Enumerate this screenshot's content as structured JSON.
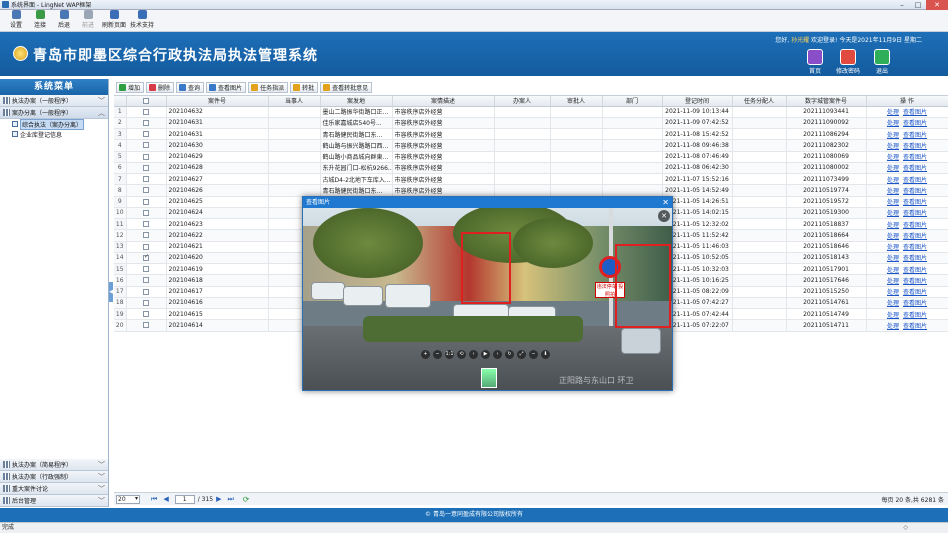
{
  "window": {
    "title": "系统界面 - LingNet WAP框架"
  },
  "toolbar": [
    {
      "label": "设置",
      "color": "#4a78b5",
      "disabled": false
    },
    {
      "label": "连接",
      "color": "#3a9a45",
      "disabled": false
    },
    {
      "label": "后退",
      "color": "#4a78b5",
      "disabled": false
    },
    {
      "label": "前进",
      "color": "#9aa6b5",
      "disabled": true
    },
    {
      "label": "刷新页面",
      "color": "#3a6fb8",
      "disabled": false
    },
    {
      "label": "技术支持",
      "color": "#3a6fb8",
      "disabled": false
    }
  ],
  "header": {
    "title": "青岛市即墨区综合行政执法局执法管理系统",
    "greeting_prefix": "您好,",
    "username": "孙光耀",
    "greeting_suffix": "欢迎登录!   今天是2021年11月9日 星期二",
    "buttons": [
      {
        "label": "首页",
        "color": "#8a4fc8"
      },
      {
        "label": "修改密码",
        "color": "#e04a3f"
      },
      {
        "label": "退出",
        "color": "#2fae5a"
      }
    ]
  },
  "sidebar": {
    "title": "系统菜单",
    "groups_top": [
      {
        "label": "执法办案（一般程序）",
        "chevron": "﹀",
        "open": false
      },
      {
        "label": "案办分离（一般程序）",
        "chevron": "︿",
        "open": true
      }
    ],
    "items": [
      {
        "label": "综合执法（案办分离）",
        "active": true
      },
      {
        "label": "企业库登记信息",
        "active": false
      }
    ],
    "groups_bottom": [
      {
        "label": "执法办案（简易程序）",
        "chevron": "﹀"
      },
      {
        "label": "执法办案（行政强制）",
        "chevron": "﹀"
      },
      {
        "label": "重大案件讨论",
        "chevron": "﹀"
      },
      {
        "label": "后台管理",
        "chevron": "﹀"
      }
    ]
  },
  "actions": [
    {
      "label": "增加",
      "color": "#2ea043"
    },
    {
      "label": "删除",
      "color": "#d73a49"
    },
    {
      "label": "查询",
      "color": "#3a78c8"
    },
    {
      "label": "查看图片",
      "color": "#3a78c8"
    },
    {
      "label": "任务指派",
      "color": "#e2a21b"
    },
    {
      "label": "转批",
      "color": "#e2a21b"
    },
    {
      "label": "查看转批意见",
      "color": "#e2a21b"
    }
  ],
  "table": {
    "columns": [
      "",
      "",
      "案件号",
      "当事人",
      "案发地",
      "案情描述",
      "办案人",
      "审批人",
      "部门",
      "登记时间",
      "任务分配人",
      "数字城管案件号",
      "操 作"
    ],
    "action_links": [
      "处理",
      "查看图片"
    ],
    "rows": [
      {
        "n": "1",
        "checked": false,
        "case_no": "202104632",
        "party": "",
        "place": "墨山二路振华街路口正...",
        "desc": "市容秩序店外经营",
        "handler": "",
        "approver": "",
        "dept": "",
        "time": "2021-11-09 10:13:44",
        "assigner": "",
        "city_no": "202111093441"
      },
      {
        "n": "2",
        "checked": false,
        "case_no": "202104631",
        "party": "",
        "place": "佳乐家嘉城店540号...",
        "desc": "市容秩序店外经营",
        "handler": "",
        "approver": "",
        "dept": "",
        "time": "2021-11-09 07:42:52",
        "assigner": "",
        "city_no": "202111090092"
      },
      {
        "n": "3",
        "checked": false,
        "case_no": "202104631",
        "party": "",
        "place": "青石路健民街路口东...",
        "desc": "市容秩序店外经营",
        "handler": "",
        "approver": "",
        "dept": "",
        "time": "2021-11-08 15:42:52",
        "assigner": "",
        "city_no": "202111086294"
      },
      {
        "n": "4",
        "checked": false,
        "case_no": "202104630",
        "party": "",
        "place": "鹤山路与振兴路路口西...",
        "desc": "市容秩序店外经营",
        "handler": "",
        "approver": "",
        "dept": "",
        "time": "2021-11-08 09:46:38",
        "assigner": "",
        "city_no": "202111082302"
      },
      {
        "n": "5",
        "checked": false,
        "case_no": "202104629",
        "party": "",
        "place": "鹤山路小商品城向群東...",
        "desc": "市容秩序店外经营",
        "handler": "",
        "approver": "",
        "dept": "",
        "time": "2021-11-08 07:46:49",
        "assigner": "",
        "city_no": "202111080069"
      },
      {
        "n": "6",
        "checked": false,
        "case_no": "202104628",
        "party": "",
        "place": "东升花园门口-松杭9266...",
        "desc": "市容秩序店外经营",
        "handler": "",
        "approver": "",
        "dept": "",
        "time": "2021-11-08 06:42:30",
        "assigner": "",
        "city_no": "202111080002"
      },
      {
        "n": "7",
        "checked": false,
        "case_no": "202104627",
        "party": "",
        "place": "古城D4-2北地下车库入...",
        "desc": "市容秩序店外经营",
        "handler": "",
        "approver": "",
        "dept": "",
        "time": "2021-11-07 15:52:16",
        "assigner": "",
        "city_no": "202111073499"
      },
      {
        "n": "8",
        "checked": false,
        "case_no": "202104626",
        "party": "",
        "place": "青石路健民街路口东...",
        "desc": "市容秩序店外经营",
        "handler": "",
        "approver": "",
        "dept": "",
        "time": "2021-11-05 14:52:49",
        "assigner": "",
        "city_no": "202110519774"
      },
      {
        "n": "9",
        "checked": false,
        "case_no": "202104625",
        "party": "",
        "place": "",
        "desc": "",
        "handler": "",
        "approver": "",
        "dept": "",
        "time": "2021-11-05 14:26:51",
        "assigner": "",
        "city_no": "202110519572"
      },
      {
        "n": "10",
        "checked": false,
        "case_no": "202104624",
        "party": "",
        "place": "",
        "desc": "",
        "handler": "",
        "approver": "",
        "dept": "",
        "time": "2021-11-05 14:02:15",
        "assigner": "",
        "city_no": "202110519300"
      },
      {
        "n": "11",
        "checked": false,
        "case_no": "202104623",
        "party": "",
        "place": "",
        "desc": "",
        "handler": "",
        "approver": "",
        "dept": "",
        "time": "2021-11-05 12:32:02",
        "assigner": "",
        "city_no": "202110518837"
      },
      {
        "n": "12",
        "checked": false,
        "case_no": "202104622",
        "party": "",
        "place": "",
        "desc": "",
        "handler": "",
        "approver": "",
        "dept": "",
        "time": "2021-11-05 11:52:42",
        "assigner": "",
        "city_no": "202110518664"
      },
      {
        "n": "13",
        "checked": false,
        "case_no": "202104621",
        "party": "",
        "place": "",
        "desc": "",
        "handler": "",
        "approver": "",
        "dept": "",
        "time": "2021-11-05 11:46:03",
        "assigner": "",
        "city_no": "202110518646"
      },
      {
        "n": "14",
        "checked": true,
        "case_no": "202104620",
        "party": "",
        "place": "",
        "desc": "",
        "handler": "",
        "approver": "",
        "dept": "",
        "time": "2021-11-05 10:52:05",
        "assigner": "",
        "city_no": "202110518143"
      },
      {
        "n": "15",
        "checked": false,
        "case_no": "202104619",
        "party": "",
        "place": "",
        "desc": "",
        "handler": "",
        "approver": "",
        "dept": "",
        "time": "2021-11-05 10:32:03",
        "assigner": "",
        "city_no": "202110517901"
      },
      {
        "n": "16",
        "checked": false,
        "case_no": "202104618",
        "party": "",
        "place": "",
        "desc": "",
        "handler": "",
        "approver": "",
        "dept": "",
        "time": "2021-11-05 10:16:25",
        "assigner": "",
        "city_no": "202110517646"
      },
      {
        "n": "17",
        "checked": false,
        "case_no": "202104617",
        "party": "",
        "place": "",
        "desc": "",
        "handler": "",
        "approver": "",
        "dept": "",
        "time": "2021-11-05 08:22:09",
        "assigner": "",
        "city_no": "202110515250"
      },
      {
        "n": "18",
        "checked": false,
        "case_no": "202104616",
        "party": "",
        "place": "",
        "desc": "",
        "handler": "",
        "approver": "",
        "dept": "",
        "time": "2021-11-05 07:42:27",
        "assigner": "",
        "city_no": "202110514761"
      },
      {
        "n": "19",
        "checked": false,
        "case_no": "202104615",
        "party": "",
        "place": "",
        "desc": "",
        "handler": "",
        "approver": "",
        "dept": "",
        "time": "2021-11-05 07:42:44",
        "assigner": "",
        "city_no": "202110514749"
      },
      {
        "n": "20",
        "checked": false,
        "case_no": "202104614",
        "party": "",
        "place": "",
        "desc": "",
        "handler": "",
        "approver": "",
        "dept": "",
        "time": "2021-11-05 07:22:07",
        "assigner": "",
        "city_no": "202110514711"
      }
    ]
  },
  "pager": {
    "page_size": "20",
    "current_page": "1",
    "total_pages": "/ 315",
    "summary": "每页 20 条,共 6281 条"
  },
  "viewer": {
    "title": "查看图片",
    "sign_text": "违法停车 投照拍",
    "watermark": "正阳路与东山口 环卫",
    "controls": [
      "+",
      "−",
      "1:1",
      "⟲",
      "‹",
      "▶",
      "›",
      "↻",
      "⤢",
      "−",
      "⬇"
    ]
  },
  "footer": {
    "text": "© 青岛一意同盈成有限公司版权所有"
  },
  "status": {
    "left": "完成",
    "right": "◇"
  }
}
